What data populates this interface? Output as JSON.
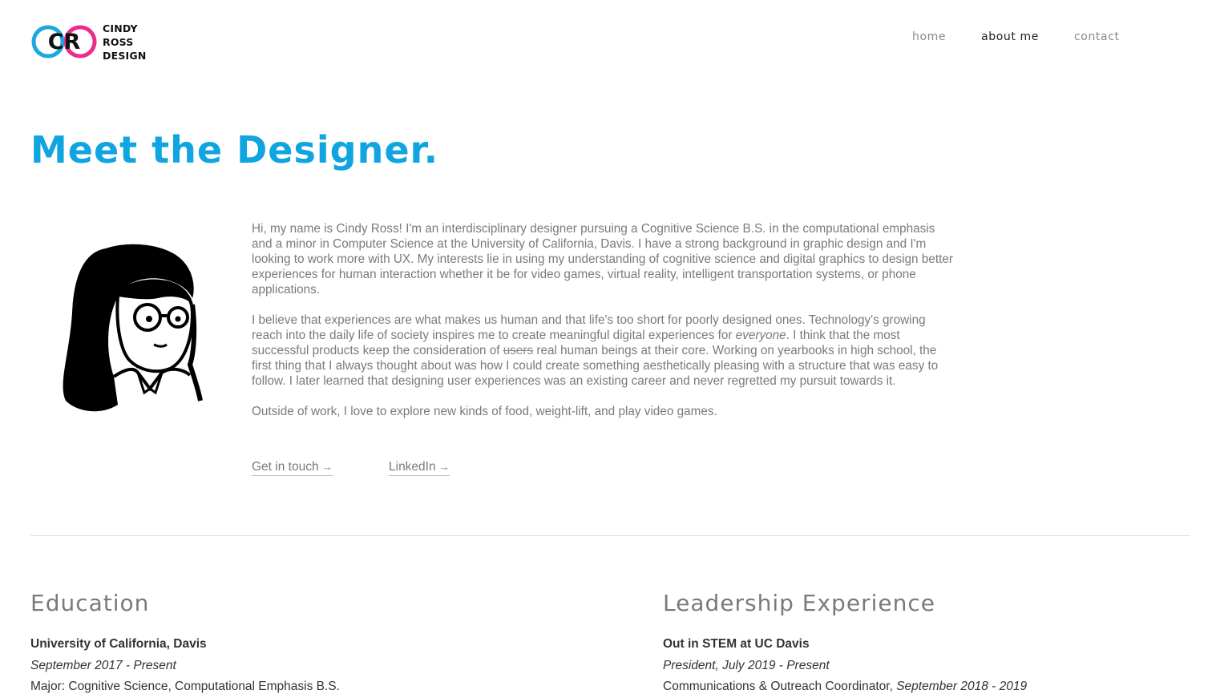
{
  "logo": {
    "monogram": "CR",
    "text_lines": [
      "CINDY",
      "ROSS",
      "DESIGN"
    ],
    "colors": {
      "cyan": "#1ba8e0",
      "magenta": "#ea2d8c"
    }
  },
  "nav": {
    "items": [
      {
        "label": "home",
        "active": false
      },
      {
        "label": "about me",
        "active": true
      },
      {
        "label": "contact",
        "active": false
      }
    ]
  },
  "page": {
    "title": "Meet the Designer.",
    "accent_color": "#0ea5e0"
  },
  "avatar": {
    "icon": "designer-portrait-illustration"
  },
  "bio": {
    "paragraph1": "Hi, my name is Cindy Ross! I'm an interdisciplinary designer pursuing a Cognitive Science B.S. in the computational emphasis and a minor in Computer Science at the University of California, Davis. I have a strong background in graphic design and I'm looking to work more with UX. My interests lie in using my understanding of cognitive science and digital graphics to design better experiences for human interaction whether it be for video games, virtual reality, intelligent transportation systems, or phone applications.",
    "paragraph2_part1": "I believe that experiences are what makes us human and that life's too short for poorly designed ones. Technology's growing reach into the daily life of society inspires me to create meaningful digital experiences for ",
    "paragraph2_em": "everyone",
    "paragraph2_part2": ". I think that the most successful products keep the consideration of ",
    "paragraph2_strike": "users",
    "paragraph2_part3": " real human beings at their core. Working on yearbooks in high school, the first thing that I always thought about was how I could create something aesthetically pleasing with a structure that was easy to follow. I later learned that designing user experiences was an existing career and never regretted my pursuit towards it.",
    "paragraph3": "Outside of work, I love to explore new kinds of food, weight-lift, and play video games."
  },
  "links": {
    "get_in_touch": "Get in touch",
    "linkedin": "LinkedIn",
    "arrow": "→"
  },
  "education": {
    "heading": "Education",
    "school": "University of California, Davis",
    "dates": "September 2017 - Present",
    "major": "Major: Cognitive Science, Computational Emphasis B.S."
  },
  "leadership": {
    "heading": "Leadership Experience",
    "org": "Out in STEM at UC Davis",
    "role": "President, July 2019 - Present",
    "role2_title": "Communications & Outreach Coordinator, ",
    "role2_dates": "September 2018 - 2019"
  }
}
